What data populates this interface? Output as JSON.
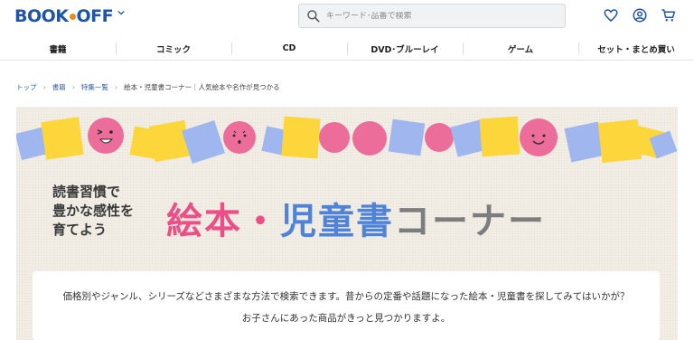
{
  "header": {
    "logo_text_left": "BOOK",
    "logo_text_right": "OFF",
    "logo_accent_color": "#f08a16",
    "brand_color": "#1f55a8",
    "search_placeholder": "キーワード･品番で検索",
    "icons": [
      "search-icon",
      "heart-icon",
      "account-icon",
      "cart-icon",
      "chevron-down-icon"
    ]
  },
  "nav": {
    "items": [
      {
        "label": "書籍"
      },
      {
        "label": "コミック"
      },
      {
        "label": "CD"
      },
      {
        "label": "DVD･ブルーレイ"
      },
      {
        "label": "ゲーム"
      },
      {
        "label": "セット・まとめ買い"
      }
    ]
  },
  "breadcrumb": {
    "items": [
      "トップ",
      "書籍",
      "特集一覧"
    ],
    "current": "絵本・児童書コーナー｜人気絵本や名作が見つかる"
  },
  "banner": {
    "tagline": [
      "読書習慣で",
      "豊かな感性を",
      "育てよう"
    ],
    "title_pink": "絵本",
    "title_dot": "・",
    "title_blue": "児童書",
    "title_gray": "コーナー",
    "colors": {
      "pink": "#ec4f86",
      "blue": "#4f83d8",
      "yellow": "#fcd63a",
      "gray": "#7d7d7d"
    }
  },
  "description": {
    "line1": "価格別やジャンル、シリーズなどさまざまな方法で検索できます。昔からの定番や話題になった絵本・児童書を探してみてはいかが？",
    "line2": "お子さんにあった商品がきっと見つかりますよ。"
  }
}
